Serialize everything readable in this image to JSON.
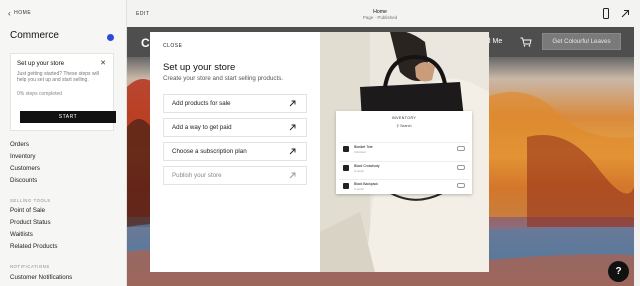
{
  "sidebar": {
    "back_label": "HOME",
    "title": "Commerce",
    "setup_card": {
      "title": "Set up your store",
      "description": "Just getting started? These steps will help you set up and start selling.",
      "progress": "0% steps completed",
      "start_label": "START"
    },
    "nav_main": [
      "Orders",
      "Inventory",
      "Customers",
      "Discounts"
    ],
    "section_selling": "SELLING TOOLS",
    "nav_selling": [
      "Point of Sale",
      "Product Status",
      "Waitlists",
      "Related Products"
    ],
    "section_notifications": "NOTIFICATIONS",
    "nav_notifications": [
      "Customer Notifications"
    ]
  },
  "topbar": {
    "edit_label": "EDIT",
    "page_name": "Home",
    "page_status": "Page · Published"
  },
  "preview": {
    "logo_fragment": "C",
    "nav_link": "Ad Me",
    "cta_label": "Get Colourful Leaves"
  },
  "modal": {
    "close_label": "CLOSE",
    "title": "Set up your store",
    "subtitle": "Create your store and start selling products.",
    "tasks": [
      {
        "label": "Add products for sale"
      },
      {
        "label": "Add a way to get paid"
      },
      {
        "label": "Choose a subscription plan"
      },
      {
        "label": "Publish your store"
      }
    ],
    "inventory": {
      "heading": "INVENTORY",
      "search": "Search",
      "items": [
        {
          "name": "Blanket Tote",
          "status": "Unlimited"
        },
        {
          "name": "Black Crossbody",
          "status": "In stock"
        },
        {
          "name": "Black Backpack",
          "status": "In stock"
        }
      ]
    }
  },
  "help_label": "?"
}
